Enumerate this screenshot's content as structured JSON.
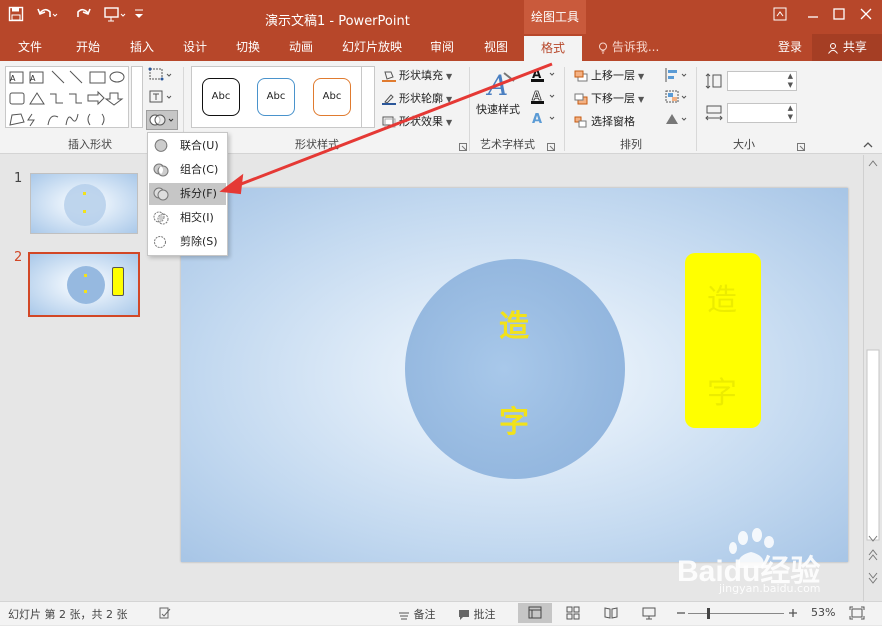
{
  "titlebar": {
    "doc_title": "演示文稿1 - PowerPoint",
    "contextual_group": "绘图工具",
    "quick_access": [
      "save-icon",
      "undo-icon",
      "redo-icon",
      "present-icon",
      "customize-icon"
    ]
  },
  "tabs": [
    {
      "label": "文件"
    },
    {
      "label": "开始"
    },
    {
      "label": "插入"
    },
    {
      "label": "设计"
    },
    {
      "label": "切换"
    },
    {
      "label": "动画"
    },
    {
      "label": "幻灯片放映"
    },
    {
      "label": "审阅"
    },
    {
      "label": "视图"
    },
    {
      "label": "格式",
      "active": true
    }
  ],
  "tell_me": "告诉我...",
  "login": "登录",
  "share": "共享",
  "ribbon": {
    "groups": {
      "insert_shapes": "插入形状",
      "shape_styles": "形状样式",
      "wordart_styles": "艺术字样式",
      "arrange": "排列",
      "size": "大小"
    },
    "style_preset_label": "Abc",
    "shape_fill": "形状填充",
    "shape_outline": "形状轮廓",
    "shape_effects": "形状效果",
    "quick_styles": "快速样式",
    "bring_forward": "上移一层",
    "send_backward": "下移一层",
    "selection_pane": "选择窗格"
  },
  "merge_menu": [
    {
      "label": "联合(U)",
      "icon": "union-icon"
    },
    {
      "label": "组合(C)",
      "icon": "combine-icon"
    },
    {
      "label": "拆分(F)",
      "icon": "fragment-icon",
      "highlighted": true
    },
    {
      "label": "相交(I)",
      "icon": "intersect-icon"
    },
    {
      "label": "剪除(S)",
      "icon": "subtract-icon"
    }
  ],
  "thumbnails": [
    {
      "number": "1"
    },
    {
      "number": "2",
      "selected": true
    }
  ],
  "slide": {
    "char_top": "造",
    "char_bottom": "字",
    "box_char_top": "造",
    "box_char_bottom": "字"
  },
  "statusbar": {
    "slide_info": "幻灯片 第 2 张，共 2 张",
    "notes": "备注",
    "comments": "批注",
    "zoom": "53%"
  },
  "watermark": {
    "brand": "Baidu经验",
    "url": "jingyan.baidu.com"
  },
  "colors": {
    "accent": "#b7472a",
    "slide_circle": "#96b9e0",
    "yellow_box": "#ffff00",
    "glyph": "#f2e21a",
    "annotation_arrow": "#e53935"
  }
}
